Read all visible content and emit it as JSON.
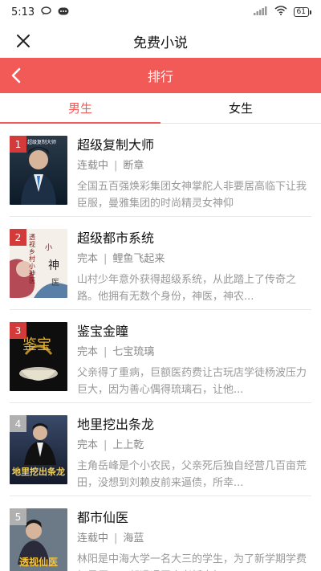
{
  "status_bar": {
    "time": "5:13",
    "icons": [
      "cloud-chat-icon",
      "message-icon"
    ],
    "right_icons": [
      "signal-icon",
      "wifi-icon"
    ],
    "battery": "61"
  },
  "title_bar": {
    "title": "免费小说",
    "close_icon": "close-icon"
  },
  "rank_bar": {
    "title": "排行",
    "back_icon": "back-arrow-icon"
  },
  "tabs": [
    {
      "label": "男生",
      "active": true
    },
    {
      "label": "女生",
      "active": false
    }
  ],
  "colors": {
    "accent": "#f25a57",
    "rank_top": "#d33a3a",
    "rank_other": "#b0b0b0"
  },
  "books": [
    {
      "rank": "1",
      "title": "超级复制大师",
      "status": "连载中",
      "author": "断章",
      "desc": "全国五百强焕彩集团女神掌舵人非要居高临下让我臣服，曼雅集团的时尚精灵女神仰",
      "cover_text": "超级复制大师"
    },
    {
      "rank": "2",
      "title": "超级都市系统",
      "status": "完本",
      "author": "鲤鱼飞起来",
      "desc": "山村少年意外获得超级系统，从此踏上了传奇之路。他拥有无数个身份，神医，神农...",
      "cover_text": "透视乡村小神医"
    },
    {
      "rank": "3",
      "title": "鉴宝金瞳",
      "status": "完本",
      "author": "七宝琉璃",
      "desc": "父亲得了重病，巨额医药费让古玩店学徒杨波压力巨大，因为善心偶得琉璃石，让他...",
      "cover_text": "鉴宝"
    },
    {
      "rank": "4",
      "title": "地里挖出条龙",
      "status": "完本",
      "author": "上上乾",
      "desc": "主角岳峰是个小农民，父亲死后独自经营几百亩荒田，没想到刘赖皮前来逼债，所幸...",
      "cover_text": "地里挖出条龙"
    },
    {
      "rank": "5",
      "title": "都市仙医",
      "status": "连载中",
      "author": "海蓝",
      "desc": "林阳是中海大学一名大三的学生，为了新学期学费打暑假工，却遭遇无良老板克扣工...",
      "cover_text": "透视仙医"
    }
  ]
}
